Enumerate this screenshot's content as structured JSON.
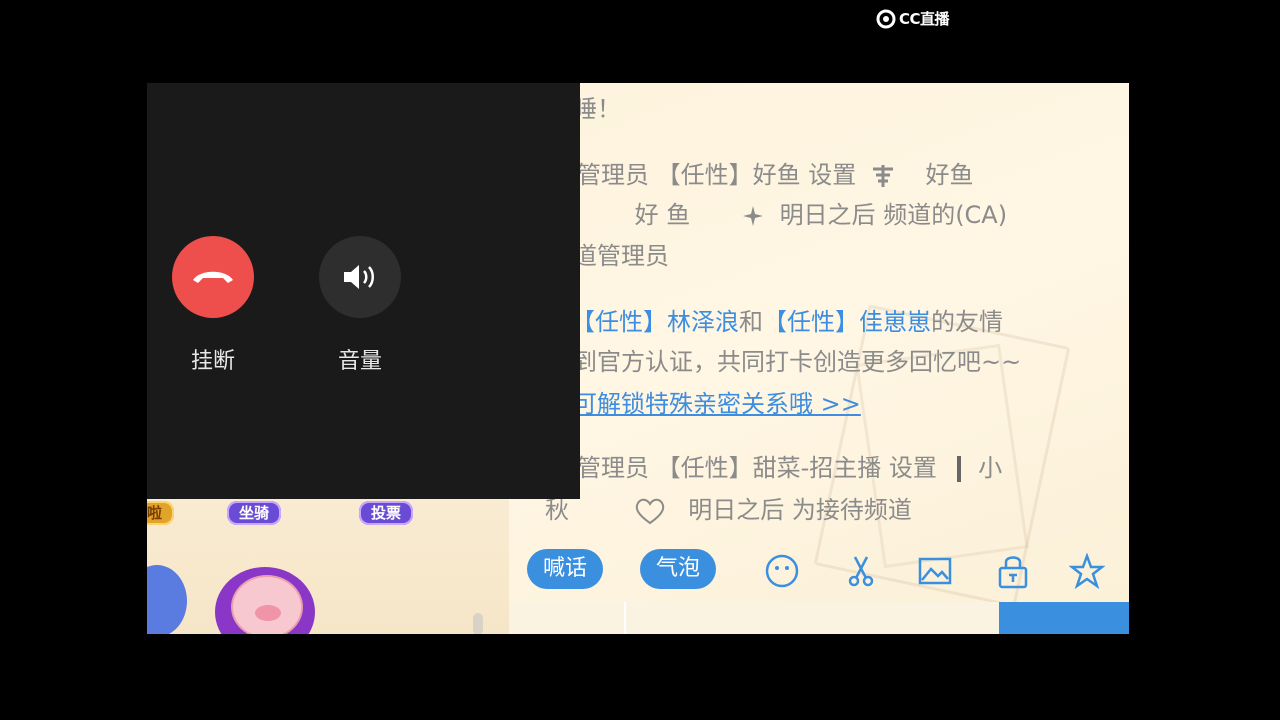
{
  "watermark": {
    "text": "CC直播"
  },
  "call": {
    "hangup_label": "挂断",
    "volume_label": "音量",
    "hangup_color": "#ee4f4c",
    "icons": [
      "phone-hangup-icon",
      "speaker-icon"
    ]
  },
  "left": {
    "gift_labels": [
      "啦",
      "坐骑",
      "投票"
    ]
  },
  "chat": {
    "l1": "睡！",
    "l2": "管理员  【任性】好鱼  设置",
    "l2b": "好鱼",
    "l3a": "好  鱼",
    "l3b": "明日之后  频道的(CA)",
    "l4": "道管理员",
    "l5_a": "【任性】林泽浪",
    "l5_b": "和",
    "l5_c": "【任性】佳崽崽",
    "l5_d": "的友情",
    "l6": "到官方认证，共同打卡创造更多回忆吧~~",
    "l7": "可解锁特殊亲密关系哦  >>",
    "l8": "管理员  【任性】甜菜-招主播  设置",
    "l8b": "小",
    "l9a": "秋",
    "l9b": "明日之后  为接待频道"
  },
  "toolbar": {
    "shout_label": "喊话",
    "bubble_label": "气泡",
    "accent_color": "#3a8fdf",
    "icons": [
      "emoji-icon",
      "scissors-icon",
      "image-icon",
      "lock-icon",
      "star-icon"
    ]
  }
}
